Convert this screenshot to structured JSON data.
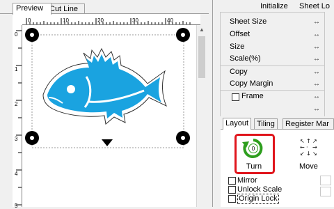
{
  "preview_tabs": [
    {
      "label": "Preview",
      "active": true
    },
    {
      "label": "Cut Line",
      "active": false
    }
  ],
  "ruler": {
    "h_labels": [
      "0",
      "10",
      "20",
      "30",
      "40"
    ],
    "v_labels": [
      "0",
      "1",
      "2",
      "3",
      "4",
      "5"
    ]
  },
  "right_header": {
    "initialize": "Initialize",
    "sheet_lock": "Sheet Lo"
  },
  "properties": {
    "sheet_size": "Sheet Size",
    "offset": "Offset",
    "size": "Size",
    "scale": "Scale(%)",
    "copy": "Copy",
    "copy_margin": "Copy Margin",
    "frame": "Frame",
    "arrow": "↔"
  },
  "bottom_tabs": [
    {
      "label": "Layout",
      "active": true
    },
    {
      "label": "Tiling",
      "active": false
    },
    {
      "label": "Register Mar",
      "active": false
    }
  ],
  "layout": {
    "turn_label": "Turn",
    "move_label": "Move",
    "mirror": "Mirror",
    "unlock_scale": "Unlock Scale",
    "origin_lock": "Origin Lock"
  },
  "colors": {
    "fish": "#1aa3e0",
    "turn_accent": "#2e9e1e",
    "turn_border": "#e0151c"
  }
}
